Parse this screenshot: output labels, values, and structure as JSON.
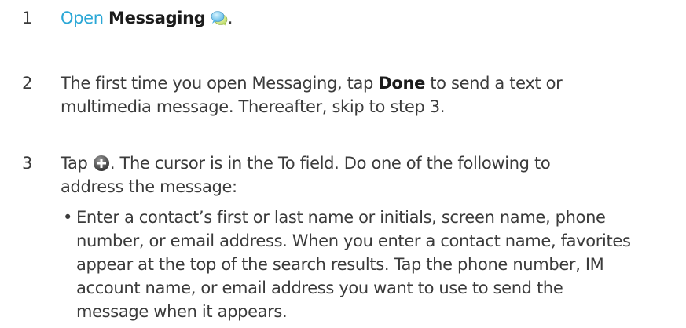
{
  "steps": [
    {
      "number": "1",
      "link_text": "Open",
      "bold_text": "Messaging",
      "icon": "messaging-bubbles-icon",
      "tail": "."
    },
    {
      "number": "2",
      "text_before": "The first time you open Messaging, tap ",
      "bold_text": "Done",
      "text_after": " to send a text or multimedia message. Thereafter, skip to step 3."
    },
    {
      "number": "3",
      "text_before": "Tap ",
      "icon": "new-message-plus-icon",
      "text_after": ". The cursor is in the To field. Do one of the following to address the message:"
    }
  ],
  "bullets": [
    {
      "marker": "•",
      "text": "Enter a contact’s first or last name or initials, screen name, phone number, or email address. When you enter a contact name, favorites appear at the top of the search results. Tap the phone number, IM account name, or email address you want to use to send the message when it appears."
    }
  ],
  "colors": {
    "text": "#3b3b3b",
    "link": "#2aa7d6",
    "bold": "#1c1c1c"
  }
}
